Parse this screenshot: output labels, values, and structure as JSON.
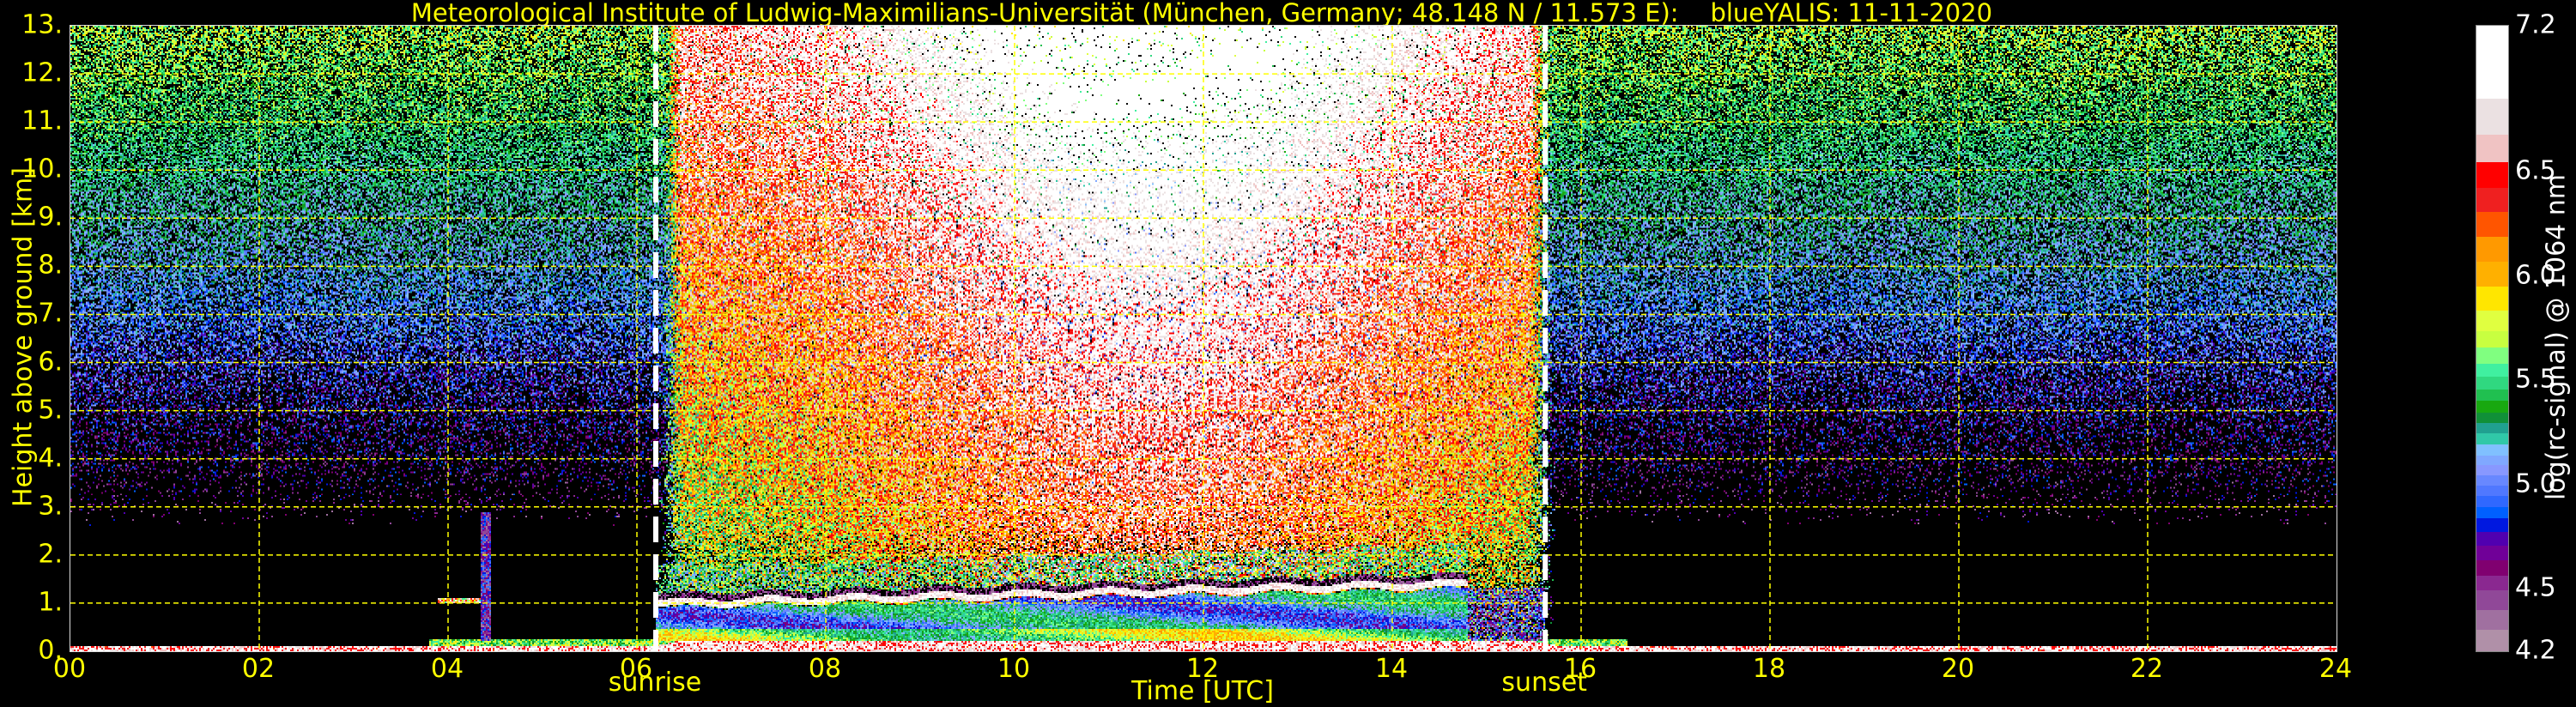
{
  "chart_data": {
    "type": "heatmap",
    "title": "Meteorological Institute of Ludwig-Maximilians-Universität (München, Germany; 48.148 N / 11.573 E):    blueYALIS: 11-11-2020",
    "xlabel": "Time [UTC]",
    "ylabel": "Height above ground [km]",
    "xlim": [
      0,
      24
    ],
    "ylim": [
      0,
      13
    ],
    "x_ticks": [
      "00",
      "02",
      "04",
      "06",
      "08",
      "10",
      "12",
      "14",
      "16",
      "18",
      "20",
      "22",
      "24"
    ],
    "x_tick_values": [
      0,
      2,
      4,
      6,
      8,
      10,
      12,
      14,
      16,
      18,
      20,
      22,
      24
    ],
    "y_ticks": [
      "0.",
      "1.",
      "2.",
      "3.",
      "4.",
      "5.",
      "6.",
      "7.",
      "8.",
      "9.",
      "10.",
      "11.",
      "12.",
      "13."
    ],
    "y_tick_values": [
      0,
      1,
      2,
      3,
      4,
      5,
      6,
      7,
      8,
      9,
      10,
      11,
      12,
      13
    ],
    "grid": true,
    "annotations": [
      {
        "label": "sunrise",
        "time": 6.2
      },
      {
        "label": "sunset",
        "time": 15.62
      }
    ],
    "colorbar": {
      "label": "log(rc-signal) @ 1064 nm",
      "range": [
        4.2,
        7.2
      ],
      "ticks": [
        "4.2",
        "4.5",
        "5.0",
        "5.5",
        "6.0",
        "6.5",
        "7.2"
      ],
      "tick_values": [
        4.2,
        4.5,
        5.0,
        5.5,
        6.0,
        6.5,
        7.2
      ],
      "boundaries": [
        4.2,
        4.304,
        4.401,
        4.494,
        4.563,
        4.639,
        4.708,
        4.773,
        4.84,
        4.892,
        4.946,
        4.998,
        5.045,
        5.093,
        5.14,
        5.192,
        5.248,
        5.298,
        5.348,
        5.402,
        5.458,
        5.518,
        5.579,
        5.657,
        5.735,
        5.836,
        5.949,
        6.072,
        6.188,
        6.307,
        6.424,
        6.547,
        6.681,
        6.854,
        7.2
      ],
      "colors": [
        "#b090a8",
        "#a070a0",
        "#904898",
        "#8a2890",
        "#800070",
        "#700098",
        "#5000b0",
        "#0018e0",
        "#0060ff",
        "#3068ff",
        "#5078ff",
        "#6888ff",
        "#8898ff",
        "#80a8ff",
        "#80c0ff",
        "#30c8a8",
        "#20a090",
        "#109038",
        "#18a810",
        "#20c050",
        "#30d880",
        "#40f0a0",
        "#80ff80",
        "#c8ff40",
        "#e0ff40",
        "#ffe600",
        "#ffb000",
        "#ff9900",
        "#ff5500",
        "#ef2020",
        "#ff0000",
        "#f0c3c3",
        "#ebe1e2",
        "#ffffff"
      ]
    },
    "features": {
      "boundary_layer_top_km": {
        "start_time": 6.5,
        "end_time": 14.8,
        "height_start": 1.0,
        "height_end": 1.4
      },
      "early_cloud": {
        "start_time": 3.9,
        "end_time": 4.45,
        "height_km": 1.05
      }
    }
  },
  "colors": {
    "text": "#ffff00",
    "grid": "#ffff00",
    "marker": "#ffffff"
  }
}
